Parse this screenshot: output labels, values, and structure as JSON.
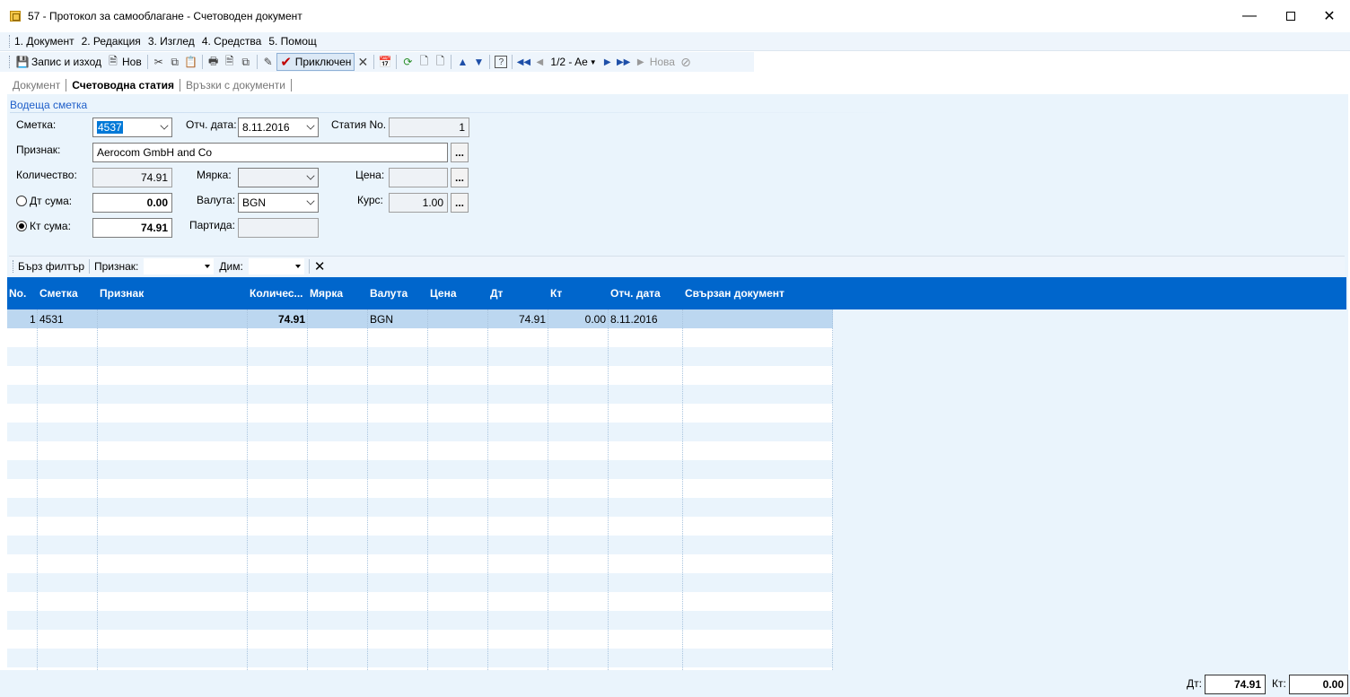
{
  "window": {
    "title": "57 - Протокол за самооблагане - Счетоводен документ"
  },
  "menu": [
    {
      "label": "1. Документ"
    },
    {
      "label": "2. Редакция"
    },
    {
      "label": "3. Изглед"
    },
    {
      "label": "4. Средства"
    },
    {
      "label": "5. Помощ"
    }
  ],
  "toolbar": {
    "save_exit": "Запис и изход",
    "new": "Нов",
    "finished": "Приключен",
    "page": "1/2 - Ae",
    "new_disabled": "Нова"
  },
  "tabs": [
    {
      "label": "Документ"
    },
    {
      "label": "Счетоводна статия"
    },
    {
      "label": "Връзки с документи"
    }
  ],
  "form": {
    "section": "Водеща сметка",
    "account_label": "Сметка:",
    "account_value": "4537",
    "report_date_label": "Отч. дата:",
    "report_date_value": "8.11.2016",
    "entry_no_label": "Статия No.",
    "entry_no_value": "1",
    "attribute_label": "Признак:",
    "attribute_value": "Aerocom GmbH and Co",
    "qty_label": "Количество:",
    "qty_value": "74.91",
    "unit_label": "Мярка:",
    "unit_value": "",
    "price_label": "Цена:",
    "price_value": "",
    "debit_label": "Дт сума:",
    "debit_value": "0.00",
    "currency_label": "Валута:",
    "currency_value": "BGN",
    "rate_label": "Курс:",
    "rate_value": "1.00",
    "credit_label": "Кт сума:",
    "credit_value": "74.91",
    "batch_label": "Партида:",
    "batch_value": "",
    "dots": "..."
  },
  "filter": {
    "quick": "Бърз филтър",
    "attribute": "Признак:",
    "dim": "Дим:"
  },
  "grid": {
    "columns": [
      "No.",
      "Сметка",
      "Признак",
      "Количес...",
      "Мярка",
      "Валута",
      "Цена",
      "Дт",
      "Кт",
      "Отч. дата",
      "Свързан документ"
    ],
    "rows": [
      {
        "no": "1",
        "account": "4531",
        "attr": "",
        "qty": "74.91",
        "unit": "",
        "currency": "BGN",
        "price": "",
        "dt": "74.91",
        "kt": "0.00",
        "date": "8.11.2016",
        "doc": ""
      }
    ]
  },
  "totals": {
    "dt_label": "Дт:",
    "dt_value": "74.91",
    "kt_label": "Кт:",
    "kt_value": "0.00"
  }
}
